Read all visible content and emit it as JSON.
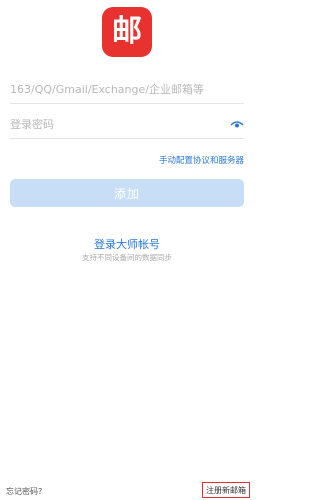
{
  "app": {
    "logo_char": "邮"
  },
  "login": {
    "account_placeholder": "163/QQ/Gmail/Exchange/企业邮箱等",
    "password_placeholder": "登录密码",
    "manual_config_label": "手动配置协议和服务器",
    "add_button_label": "添加"
  },
  "master": {
    "login_label": "登录大师帐号",
    "subtitle": "支持不同设备间的数据同步"
  },
  "footer": {
    "forgot_label": "忘记密码?",
    "register_label": "注册新邮箱"
  },
  "colors": {
    "brand_red": "#e8322f",
    "link_blue": "#2a78d6",
    "button_disabled": "#c8def7"
  },
  "icons": {
    "password_toggle": "eye-icon"
  }
}
